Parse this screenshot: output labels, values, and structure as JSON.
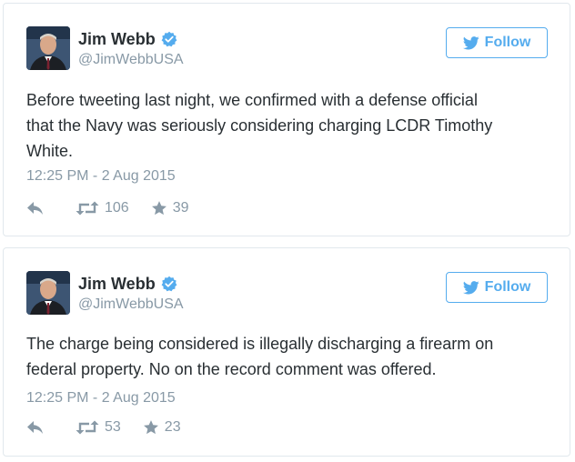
{
  "colors": {
    "accent": "#55acee",
    "text": "#292f33",
    "muted": "#8899a6",
    "border": "#e1e8ed"
  },
  "tweets": [
    {
      "author": {
        "name": "Jim Webb",
        "handle": "@JimWebbUSA",
        "verified": true
      },
      "follow_label": "Follow",
      "text": "Before tweeting last night, we confirmed with a defense official\nthat the Navy was seriously considering charging LCDR Timothy\nWhite.",
      "timestamp": "12:25 PM - 2 Aug 2015",
      "retweets": "106",
      "favorites": "39",
      "icons": {
        "reply": "reply-icon",
        "retweet": "retweet-icon",
        "favorite": "star-icon"
      }
    },
    {
      "author": {
        "name": "Jim Webb",
        "handle": "@JimWebbUSA",
        "verified": true
      },
      "follow_label": "Follow",
      "text": "The charge being considered is illegally discharging a firearm on\nfederal property. No on the record comment was offered.",
      "timestamp": "12:25 PM - 2 Aug 2015",
      "retweets": "53",
      "favorites": "23",
      "icons": {
        "reply": "reply-icon",
        "retweet": "retweet-icon",
        "favorite": "star-icon"
      }
    }
  ]
}
